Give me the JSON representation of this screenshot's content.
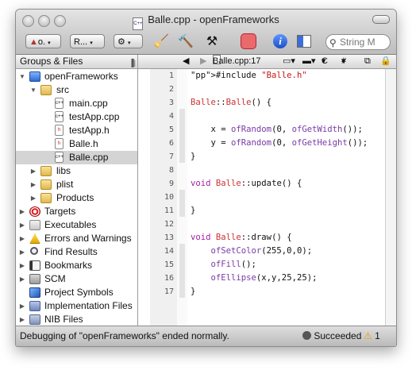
{
  "window": {
    "title": "Balle.cpp - openFrameworks"
  },
  "toolbar": {
    "config_popup": "o.",
    "run_popup": "R...",
    "action_icon": "gear-icon",
    "build_icon": "broom-icon",
    "clean_icon": "hammer-icon",
    "build_go_icon": "hammer-run-icon",
    "stop_icon": "stop-sign-icon",
    "info_icon": "info-icon",
    "editor_icon": "split-editor-icon",
    "search_placeholder": "String M"
  },
  "sidebar": {
    "header": "Groups & Files",
    "items": [
      {
        "label": "openFrameworks",
        "icon": "xcode-project-icon"
      },
      {
        "label": "src",
        "icon": "folder-icon"
      },
      {
        "label": "main.cpp",
        "icon": "cpp-file-icon"
      },
      {
        "label": "testApp.cpp",
        "icon": "cpp-file-icon"
      },
      {
        "label": "testApp.h",
        "icon": "h-file-icon"
      },
      {
        "label": "Balle.h",
        "icon": "h-file-icon"
      },
      {
        "label": "Balle.cpp",
        "icon": "cpp-file-icon"
      },
      {
        "label": "libs",
        "icon": "folder-icon"
      },
      {
        "label": "plist",
        "icon": "folder-icon"
      },
      {
        "label": "Products",
        "icon": "folder-icon"
      },
      {
        "label": "Targets",
        "icon": "target-icon"
      },
      {
        "label": "Executables",
        "icon": "executable-icon"
      },
      {
        "label": "Errors and Warnings",
        "icon": "warning-icon"
      },
      {
        "label": "Find Results",
        "icon": "search-icon"
      },
      {
        "label": "Bookmarks",
        "icon": "bookmark-icon"
      },
      {
        "label": "SCM",
        "icon": "scm-icon"
      },
      {
        "label": "Project Symbols",
        "icon": "cube-icon"
      },
      {
        "label": "Implementation Files",
        "icon": "implementation-icon"
      },
      {
        "label": "NIB Files",
        "icon": "nib-icon"
      }
    ]
  },
  "editor": {
    "file_popup": "Balle.cpp:17",
    "class_popup": "C",
    "pragma_popup": "#",
    "lines": [
      "#include \"Balle.h\"",
      "",
      "Balle::Balle() {",
      "",
      "    x = ofRandom(0, ofGetWidth());",
      "    y = ofRandom(0, ofGetHeight());",
      "}",
      "",
      "void Balle::update() {",
      "",
      "}",
      "",
      "void Balle::draw() {",
      "    ofSetColor(255,0,0);",
      "    ofFill();",
      "    ofEllipse(x,y,25,25);",
      "}"
    ]
  },
  "statusbar": {
    "message": "Debugging of \"openFrameworks\" ended normally.",
    "result": "Succeeded",
    "warnings": "1"
  },
  "colors": {
    "selection": "#d4d4d4",
    "keyword": "#a020a0",
    "string": "#c41a16",
    "class": "#cc3333"
  }
}
